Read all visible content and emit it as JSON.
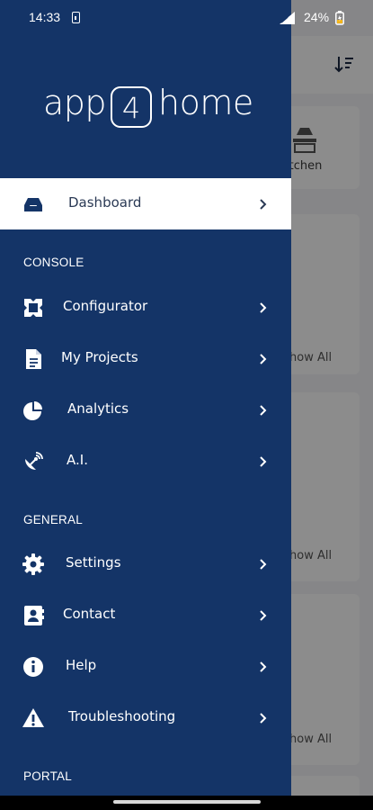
{
  "status_bar": {
    "time": "14:33",
    "battery_percent": "24%",
    "sim_icon": "sim-card-icon",
    "signal_icon": "signal-icon",
    "battery_icon": "battery-charging-icon"
  },
  "background_app": {
    "room_label": "itchen",
    "show_all_labels": [
      "how All",
      "how All",
      "how All"
    ],
    "sort_icon": "sort-descending-icon"
  },
  "drawer": {
    "logo": {
      "left": "app",
      "digit": "4",
      "right": "home"
    },
    "active_item": {
      "label": "Dashboard",
      "icon": "inbox-tray-icon"
    },
    "sections": [
      {
        "title": "CONSOLE",
        "items": [
          {
            "label": "Configurator",
            "icon": "configurator-icon"
          },
          {
            "label": "My Projects",
            "icon": "document-icon"
          },
          {
            "label": "Analytics",
            "icon": "pie-chart-icon"
          },
          {
            "label": "A.I.",
            "icon": "satellite-dish-icon"
          }
        ]
      },
      {
        "title": "GENERAL",
        "items": [
          {
            "label": "Settings",
            "icon": "gear-icon"
          },
          {
            "label": "Contact",
            "icon": "contact-card-icon"
          },
          {
            "label": "Help",
            "icon": "info-icon"
          },
          {
            "label": "Troubleshooting",
            "icon": "warning-icon"
          }
        ]
      },
      {
        "title": "PORTAL",
        "items": []
      }
    ]
  },
  "colors": {
    "drawer_bg": "#143467",
    "active_item_bg": "#FFFFFF",
    "text_light": "#FFFFFF",
    "text_dark": "#2B3A55"
  }
}
